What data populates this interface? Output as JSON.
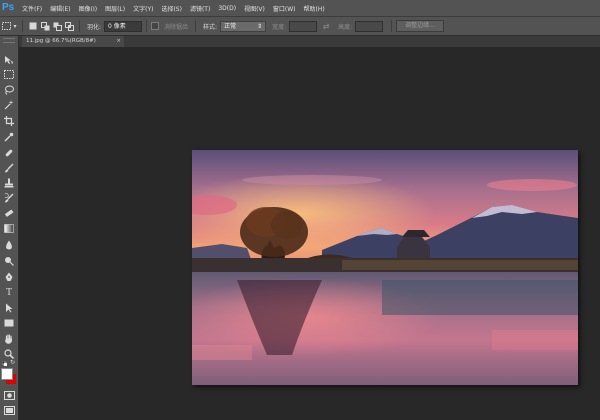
{
  "app": {
    "logo": "Ps"
  },
  "menu": [
    "文件(F)",
    "编辑(E)",
    "图像(I)",
    "图层(L)",
    "文字(Y)",
    "选择(S)",
    "滤镜(T)",
    "3D(D)",
    "视图(V)",
    "窗口(W)",
    "帮助(H)"
  ],
  "options": {
    "feather_label": "羽化:",
    "feather_value": "0 像素",
    "antialias_label": "消除锯齿",
    "style_label": "样式:",
    "style_value": "正常",
    "width_label": "宽度:",
    "height_label": "高度:",
    "refine_edge_label": "调整边缘..."
  },
  "document": {
    "tab_title": "11.jpg @ 66.7%(RGB/8#)",
    "close_glyph": "×"
  },
  "colors": {
    "foreground": "#ffffff",
    "background": "#e00000",
    "accent": "#31a8ff"
  },
  "tools": [
    "move-icon",
    "marquee-icon",
    "lasso-icon",
    "magic-wand-icon",
    "crop-icon",
    "eyedropper-icon",
    "healing-brush-icon",
    "brush-icon",
    "clone-stamp-icon",
    "history-brush-icon",
    "eraser-icon",
    "gradient-icon",
    "blur-icon",
    "dodge-icon",
    "pen-icon",
    "type-icon",
    "path-selection-icon",
    "rectangle-shape-icon",
    "hand-icon",
    "zoom-icon"
  ]
}
